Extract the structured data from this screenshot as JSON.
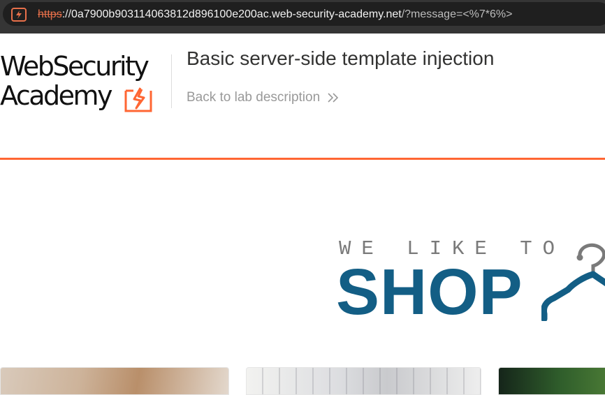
{
  "browser": {
    "url_scheme": "https",
    "url_separator": "://",
    "url_host": "0a7900b903114063812d896100e200ac.web-security-academy.net",
    "url_path": "/?message=<%7*6%>",
    "security_icon": "not-secure-warning-icon"
  },
  "header": {
    "logo_line1": "WebSecurity",
    "logo_line2": "Academy",
    "logo_mark_icon": "lightning-bolt-icon",
    "lab_title": "Basic server-side template injection",
    "back_link_label": "Back to lab description",
    "back_link_icon": "double-chevron-right-icon"
  },
  "hero": {
    "tagline": "WE LIKE TO",
    "headline": "SHOP",
    "icon": "hanger-icon"
  },
  "colors": {
    "accent_orange": "#ff6633",
    "shop_blue": "#135e85",
    "browser_dark": "#353535"
  }
}
